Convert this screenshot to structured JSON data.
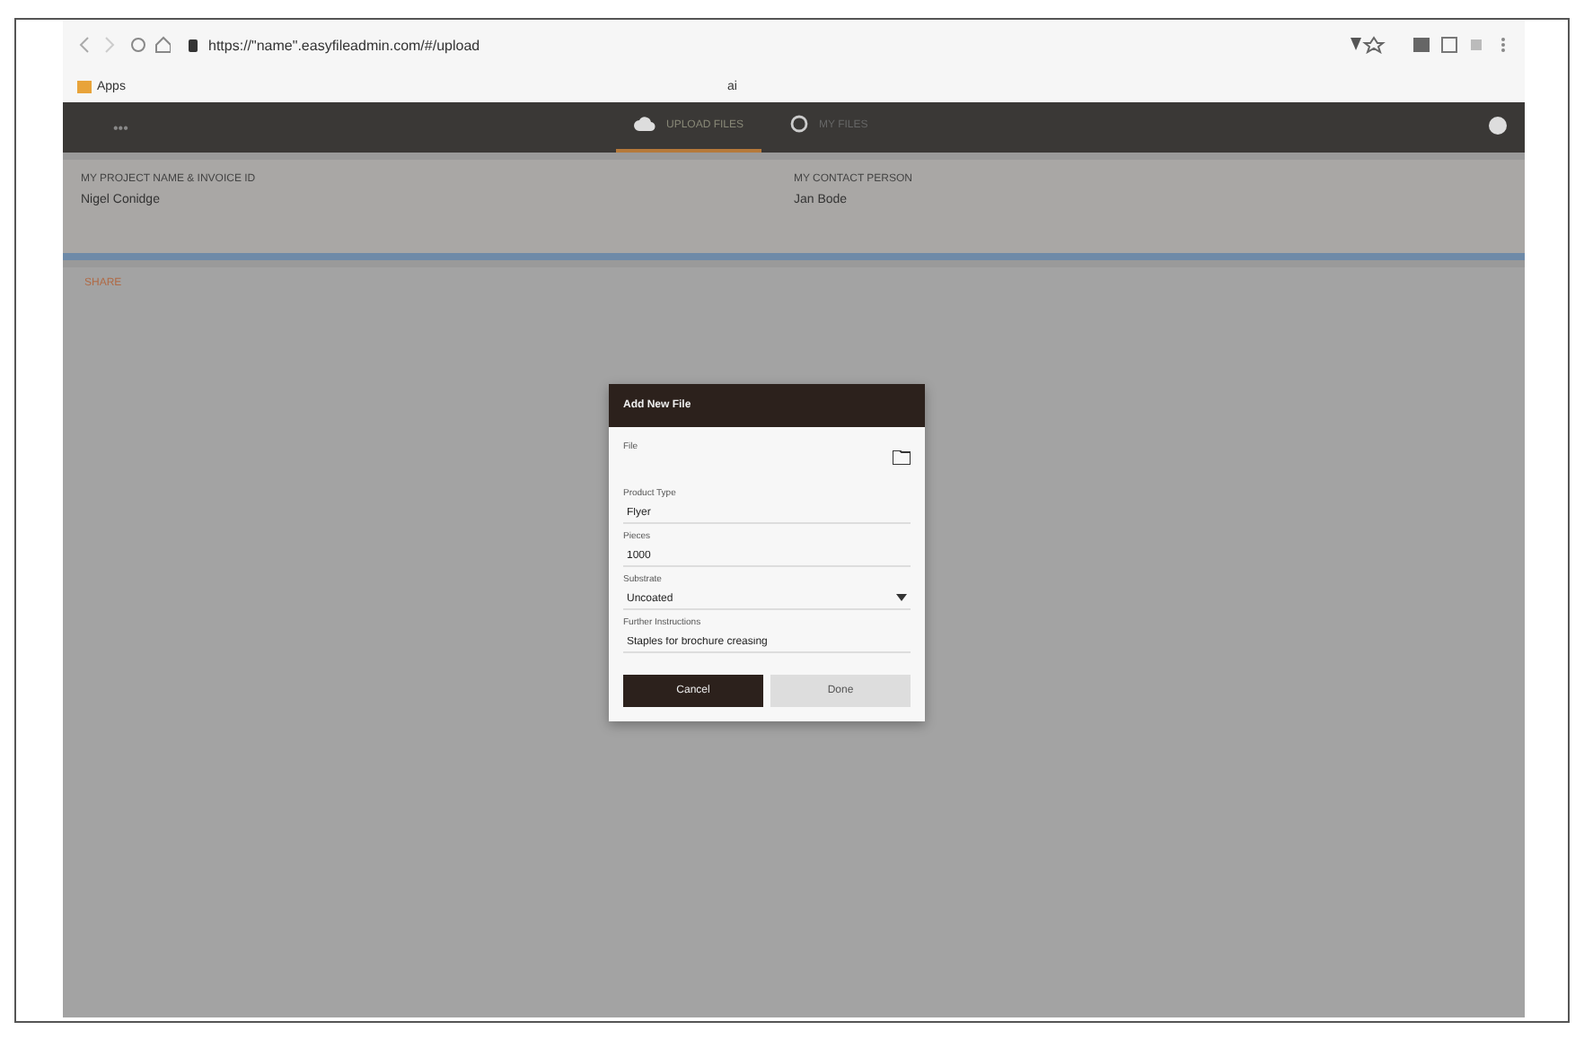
{
  "browser": {
    "url": "https://\"name\".easyfileadmin.com/#/upload",
    "bookmark": "Apps",
    "bookmark_bar_text": "ai"
  },
  "nav": {
    "brand": "•••",
    "tabs": [
      {
        "label": "UPLOAD FILES",
        "selected": true
      },
      {
        "label": "MY FILES",
        "selected": false
      }
    ]
  },
  "info": [
    {
      "label": "MY PROJECT NAME & INVOICE ID",
      "value": "Nigel Conidge"
    },
    {
      "label": "MY CONTACT PERSON",
      "value": "Jan Bode"
    }
  ],
  "section_title": "SHARE",
  "dialog": {
    "title": "Add New File",
    "file_label": "File",
    "fields": [
      {
        "kind": "text",
        "label": "Product Type",
        "value": "Flyer"
      },
      {
        "kind": "text",
        "label": "Pieces",
        "value": "1000"
      },
      {
        "kind": "select",
        "label": "Substrate",
        "value": "Uncoated"
      },
      {
        "kind": "text",
        "label": "Further Instructions",
        "value": "Staples for brochure creasing"
      }
    ],
    "buttons": [
      {
        "label": "Cancel",
        "primary": true
      },
      {
        "label": "Done",
        "primary": false
      }
    ]
  }
}
